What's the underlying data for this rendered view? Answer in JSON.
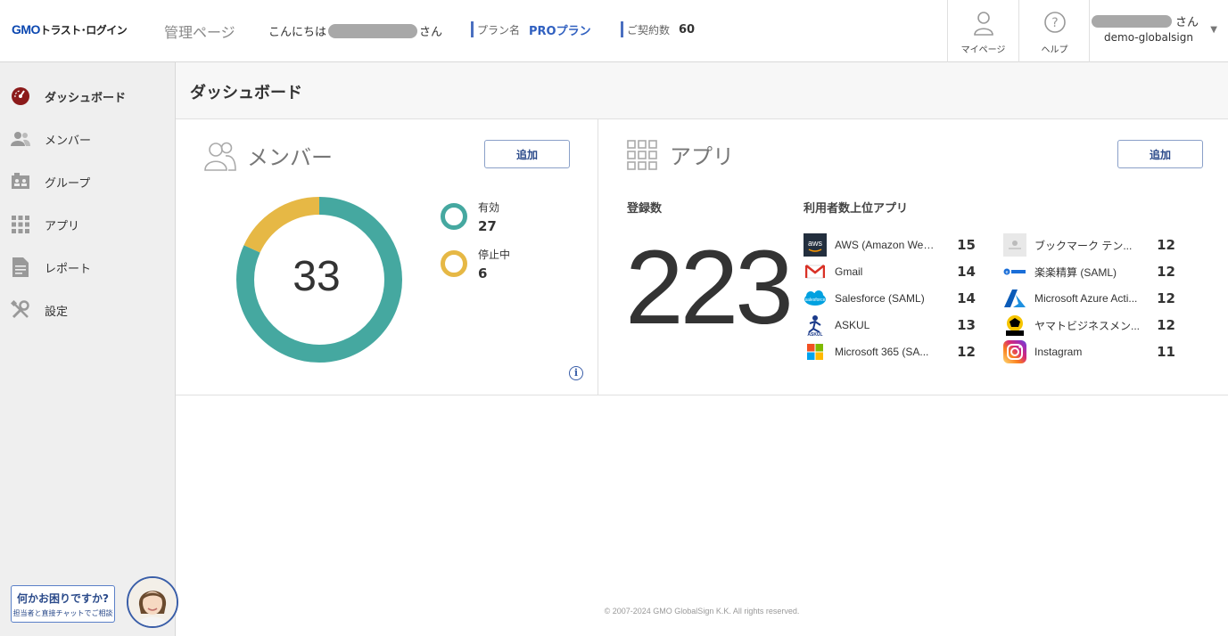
{
  "header": {
    "logo_gmo": "GMO",
    "logo_rest": "トラスト･ログイン",
    "admin_title": "管理ページ",
    "greeting_prefix": "こんにちは",
    "greeting_suffix": "さん",
    "plan_label": "プラン名",
    "plan_value": "PROプラン",
    "contract_label": "ご契約数",
    "contract_value": "60",
    "mypage_label": "マイページ",
    "help_label": "ヘルプ",
    "user_suffix": "さん",
    "tenant": "demo-globalsign"
  },
  "sidebar": {
    "items": [
      {
        "label": "ダッシュボード",
        "icon": "dashboard-icon"
      },
      {
        "label": "メンバー",
        "icon": "members-icon"
      },
      {
        "label": "グループ",
        "icon": "group-icon"
      },
      {
        "label": "アプリ",
        "icon": "apps-icon"
      },
      {
        "label": "レポート",
        "icon": "report-icon"
      },
      {
        "label": "設定",
        "icon": "settings-icon"
      }
    ],
    "chat_line1": "何かお困りですか?",
    "chat_line2": "担当者と直接チャットでご相談"
  },
  "page": {
    "title": "ダッシュボード"
  },
  "members": {
    "title": "メンバー",
    "add_label": "追加",
    "total": "33",
    "active_label": "有効",
    "active_count": "27",
    "suspended_label": "停止中",
    "suspended_count": "6",
    "active_value": 27,
    "suspended_value": 6,
    "active_color": "#45a8a0",
    "suspended_color": "#e6b845"
  },
  "apps": {
    "title": "アプリ",
    "add_label": "追加",
    "registered_label": "登録数",
    "registered_count": "223",
    "top_label": "利用者数上位アプリ",
    "left_list": [
      {
        "name": "AWS (Amazon Web ...",
        "count": "15",
        "icon": "aws-icon"
      },
      {
        "name": "Gmail",
        "count": "14",
        "icon": "gmail-icon"
      },
      {
        "name": "Salesforce (SAML)",
        "count": "14",
        "icon": "salesforce-icon"
      },
      {
        "name": "ASKUL",
        "count": "13",
        "icon": "askul-icon"
      },
      {
        "name": "Microsoft 365 (SA...",
        "count": "12",
        "icon": "microsoft-icon"
      }
    ],
    "right_list": [
      {
        "name": "ブックマーク テン...",
        "count": "12",
        "icon": "bookmark-icon"
      },
      {
        "name": "楽楽精算 (SAML)",
        "count": "12",
        "icon": "rakuraku-icon"
      },
      {
        "name": "Microsoft Azure Acti...",
        "count": "12",
        "icon": "azure-icon"
      },
      {
        "name": "ヤマトビジネスメン...",
        "count": "12",
        "icon": "yamato-icon"
      },
      {
        "name": "Instagram",
        "count": "11",
        "icon": "instagram-icon"
      }
    ]
  },
  "footer": {
    "copyright": "© 2007-2024 GMO GlobalSign K.K. All rights reserved."
  }
}
